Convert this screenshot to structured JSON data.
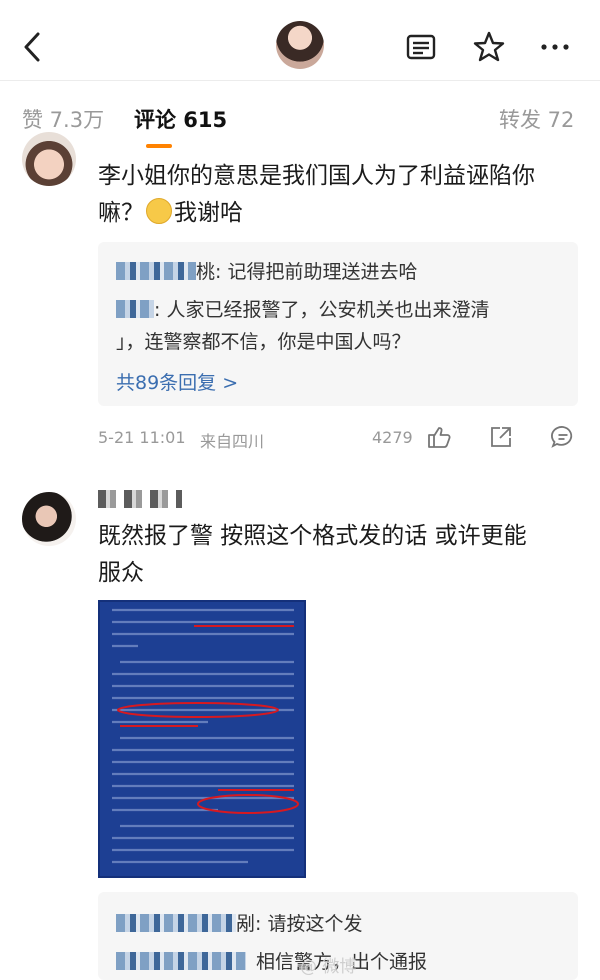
{
  "header": {
    "back_icon": "chevron-left-icon",
    "actions": [
      "reader-mode-icon",
      "star-icon",
      "more-horizontal-icon"
    ]
  },
  "tabs": {
    "likes": "赞 7.3万",
    "comments": "评论 615",
    "reposts": "转发 72",
    "accent_color": "#ff8200"
  },
  "comments": [
    {
      "text_line1": "李小姐你的意思是我们国人为了利益诬陷你",
      "text_line2_prefix": "嘛？",
      "text_line2_suffix": "我谢哈",
      "replies": [
        {
          "name_suffix": "桃",
          "text": ": 记得把前助理送进去哈"
        },
        {
          "text_line1": ": 人家已经报警了，公安机关也出来澄清",
          "text_line2": "」，连警察都不信，你是中国人吗？"
        }
      ],
      "more_replies": "共89条回复 >",
      "time": "5-21 11:01",
      "location": "来自四川",
      "like_count": "4279"
    },
    {
      "text_line1": "既然报了警 按照这个格式发的话 或许更能",
      "text_line2": "服众",
      "replies": [
        {
          "name_suffix": "剐",
          "text": ": 请按这个发"
        },
        {
          "text": "相信警方，出个通报"
        }
      ]
    }
  ],
  "image": {
    "lines": [
      "2024年9月20日，我局接三只羊公司报警称，",
      "网上传播卢某某的音视频不实，严重侵害其合",
      "法权益，我局立案开展调查，现将有关情况通报如",
      "下：",
      "在市局刑警支队指导下，经过侦查，9月22日",
      "晚，我局将犯罪嫌疑人王某某（男，25岁）抓获，",
      "并在其电脑、手机和制作AI音频的网站中发",
      "现仿造相关音视频的证据；结合其供述，调查取",
      "证，并经鉴、省专业机构检验鉴定，认定接警所",
      "涉网传音视频系伪造。",
      "现已查明，9月16日，王某某利用从互联网下",
      "载的音视频资料，私藏卢某某讲话语音片段，先",
      "使用AI工具训练生成了卢某某的音频（其中出",
      "现的女声也系AI工具训练生成），后用视频软件",
      "合成音视频，并通过网络发布，形成谣言大量传",
      "播。目前，王某某已被我局依法采取刑事强制措施，",
      "案件正在进一步侦办中。",
      "警方提醒：网络不是法外之地，请广大网民",
      "依法上网，文明用网，共同维护清朗网络空间。",
      "对编造传播谣言、扰乱公共秩序的违法犯罪行",
      "为，公安机关将依法予以严惩。"
    ]
  },
  "watermark": "@ 微博",
  "colors": {
    "link": "#3b6eb0",
    "annotation_red": "#d71920",
    "notice_blue": "#1d3f93"
  }
}
